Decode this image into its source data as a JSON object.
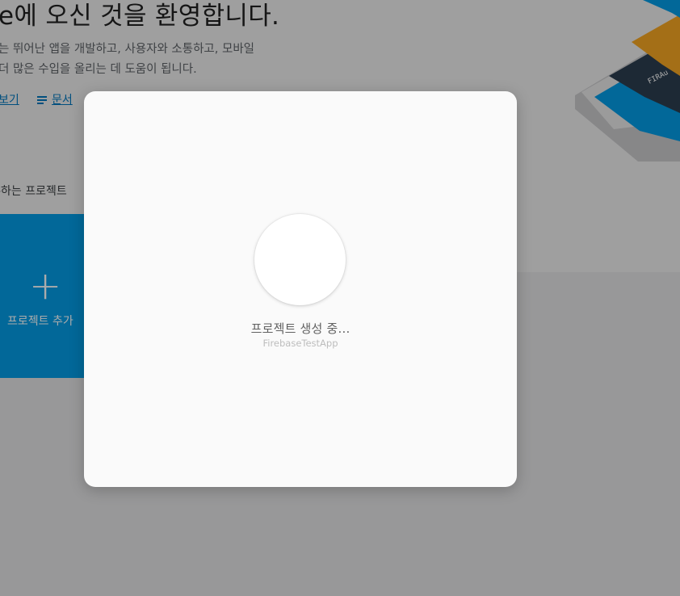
{
  "welcome": {
    "title": "e에 오신 것을 환영합니다.",
    "subtitle_line1": "는 뛰어난 앱을 개발하고, 사용자와 소통하고, 모바일",
    "subtitle_line2": "더 많은 수입을 올리는 데 도움이 됩니다.",
    "link_view": "보기",
    "link_docs": "문서"
  },
  "projects": {
    "section_title": "-하는 프로젝트",
    "add_icon": "+",
    "add_label": "프로젝트 추가"
  },
  "modal": {
    "status": "프로젝트 생성 중...",
    "project_name": "FirebaseTestApp"
  },
  "colors": {
    "brand_blue": "#039be5",
    "illustration_orange": "#f5a623",
    "illustration_navy": "#2c3e50",
    "link": "#0277bd"
  }
}
